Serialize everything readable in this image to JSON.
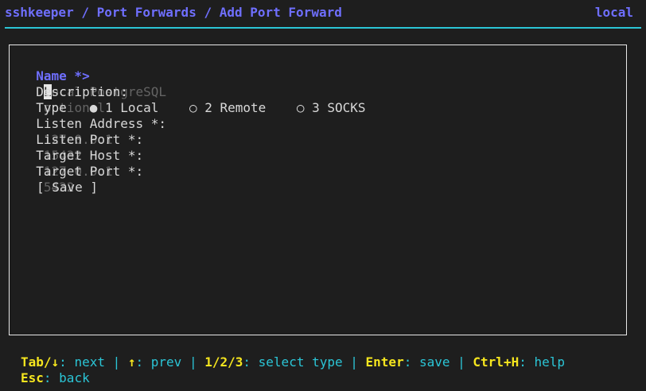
{
  "header": {
    "breadcrumb": "sshkeeper / Port Forwards / Add Port Forward",
    "mode": "local"
  },
  "form": {
    "name": {
      "label": "Name *>",
      "cursor_char": "L",
      "value_rest": "ocal PostgreSQL"
    },
    "description": {
      "label": "Description:",
      "placeholder": "optional"
    },
    "type": {
      "label": "Type",
      "options": [
        {
          "radio": "●",
          "label": "1 Local",
          "selected": true
        },
        {
          "radio": "○",
          "label": "2 Remote",
          "selected": false
        },
        {
          "radio": "○",
          "label": "3 SOCKS",
          "selected": false
        }
      ]
    },
    "listen_address": {
      "label": "Listen Address *:",
      "placeholder": "127.0.0.1"
    },
    "listen_port": {
      "label": "Listen Port *:",
      "placeholder": "15432"
    },
    "target_host": {
      "label": "Target Host *:",
      "placeholder": "127.0.0.1"
    },
    "target_port": {
      "label": "Target Port *:",
      "placeholder": "5432"
    },
    "save_label": "[ Save ]"
  },
  "help": {
    "line1": [
      {
        "key": "Tab/↓",
        "desc": ": next"
      },
      {
        "key": "↑",
        "desc": ": prev"
      },
      {
        "key": "1/2/3",
        "desc": ": select type"
      },
      {
        "key": "Enter",
        "desc": ": save"
      },
      {
        "key": "Ctrl+H",
        "desc": ": help"
      }
    ],
    "separator": " | ",
    "line2": [
      {
        "key": "Esc",
        "desc": ": back"
      }
    ]
  }
}
